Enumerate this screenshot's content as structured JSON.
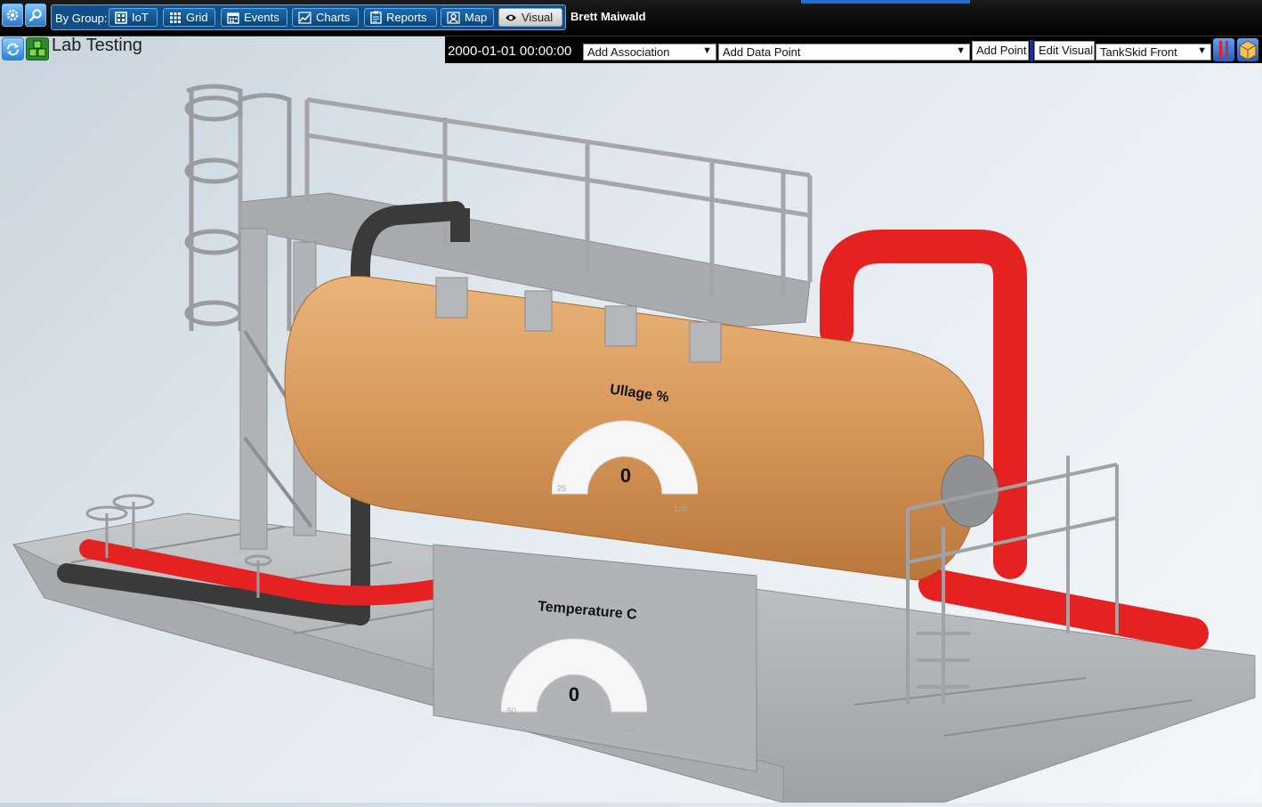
{
  "nav": {
    "group_label": "By Group:",
    "buttons": [
      {
        "label": "IoT",
        "icon": "iot-grid-icon"
      },
      {
        "label": "Grid",
        "icon": "grid-icon"
      },
      {
        "label": "Events",
        "icon": "calendar-icon"
      },
      {
        "label": "Charts",
        "icon": "line-chart-icon"
      },
      {
        "label": "Reports",
        "icon": "clipboard-icon"
      },
      {
        "label": "Map",
        "icon": "map-pin-icon"
      },
      {
        "label": "Visual",
        "icon": "eye-icon",
        "active": true
      }
    ],
    "user_name": "Brett Maiwald",
    "accent": "#1f6fd1",
    "bar_color": "#0f4f8a"
  },
  "page": {
    "title": "Lab Testing"
  },
  "toolbar": {
    "datetime": "2000-01-01 00:00:00",
    "association_select": "Add Association",
    "data_point_select": "Add Data Point",
    "add_point_label": "Add Point",
    "edit_visual_label": "Edit Visual",
    "visual_select": "TankSkid Front"
  },
  "gauges": [
    {
      "label": "Ullage %",
      "value": "0",
      "min_tick": "25",
      "max_tick": "100"
    },
    {
      "label": "Temperature C",
      "value": "0",
      "min_tick": "50",
      "max_tick": "60"
    }
  ],
  "colors": {
    "tank": "#d99a5c",
    "red_pipe": "#e52222",
    "black_pipe": "#3a3a3a",
    "frame": "#b7b8ba"
  }
}
